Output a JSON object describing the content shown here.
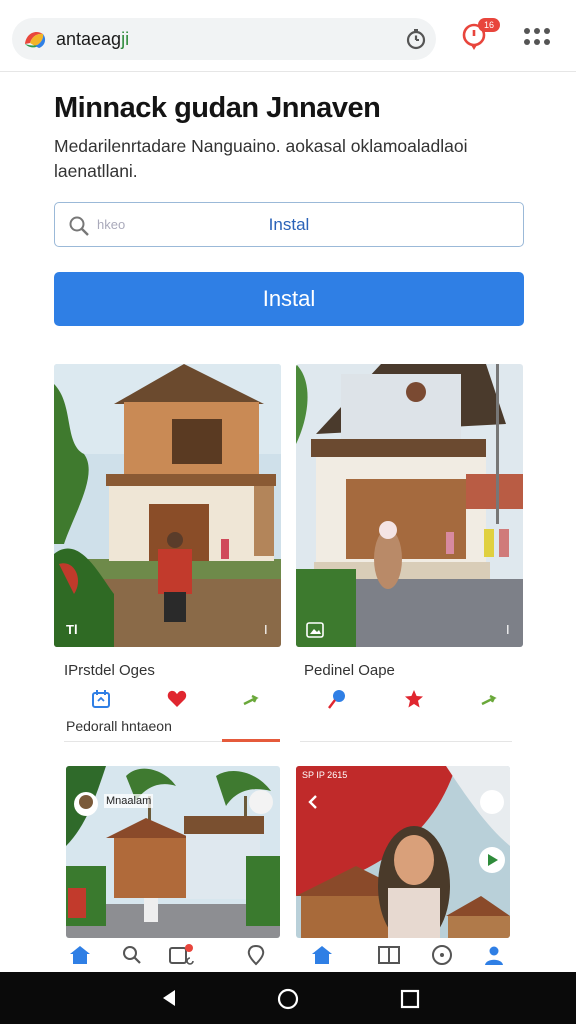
{
  "browser": {
    "site_name_prefix": "antaeag",
    "site_name_suffix": "ji",
    "notification_count": "16"
  },
  "hero": {
    "title": "Minnack gudan Jnnaven",
    "description": "Medarilenrtadare Nanguaino. aokasal oklamoaladlaoi laenatllani."
  },
  "search": {
    "placeholder": "hkeo",
    "value": "Instal"
  },
  "cta": {
    "label": "Instal"
  },
  "cards": [
    {
      "label": "IPrstdel Oges",
      "caption": "Pedorall hntaeon",
      "overlay_left": "Tl",
      "overlay_right": "I"
    },
    {
      "label": "Pedinel Oape",
      "overlay_right": "I"
    }
  ],
  "lower_cards": [
    {
      "overlay_text": "Mnaalam"
    },
    {
      "status_text": "SP IP 2615"
    }
  ],
  "colors": {
    "accent_blue": "#2f7fe5",
    "heart_red": "#e0262f",
    "underline_orange": "#e55a3b"
  },
  "icons": [
    "logo-icon",
    "timer-icon",
    "notification-icon",
    "menu-icon",
    "search-icon",
    "calendar-icon",
    "heart-icon",
    "share-icon",
    "pin-icon",
    "star-icon",
    "home-icon",
    "profile-icon"
  ]
}
